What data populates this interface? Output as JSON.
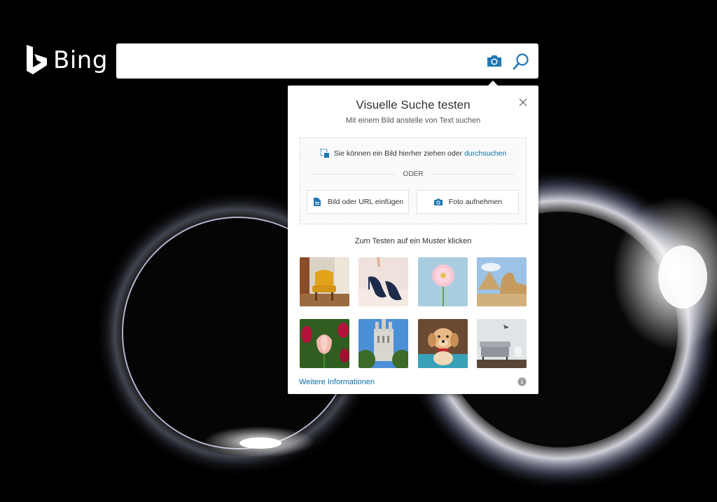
{
  "header": {
    "logo_text": "Bing",
    "search": {
      "value": "",
      "placeholder": ""
    },
    "camera_icon": "camera-icon",
    "search_icon": "magnifier-icon"
  },
  "visual_search": {
    "title": "Visuelle Suche testen",
    "subtitle": "Mit einem Bild anstelle von Text suchen",
    "drag_text": "Sie können ein Bild hierher ziehen oder",
    "browse_link": "durchsuchen",
    "or_text": "ODER",
    "paste_button": "Bild oder URL einfügen",
    "photo_button": "Foto aufnehmen",
    "samples_title": "Zum Testen auf ein Muster klicken",
    "samples": [
      "sample-chair",
      "sample-high-heels",
      "sample-pink-flower",
      "sample-sphinx",
      "sample-tulips",
      "sample-temple",
      "sample-puppy",
      "sample-living-room"
    ],
    "more_info_link": "Weitere Informationen"
  },
  "colors": {
    "accent": "#0b6ea7",
    "icon_blue": "#1f78b4",
    "background": "#000000"
  }
}
